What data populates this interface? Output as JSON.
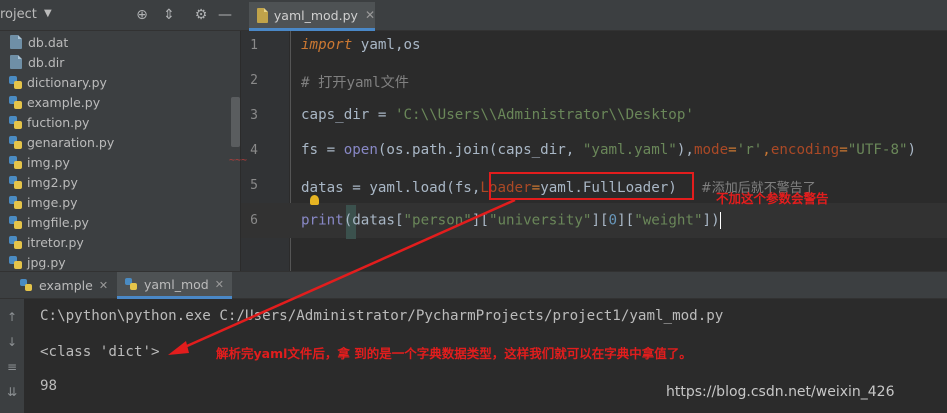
{
  "project_panel": {
    "title": "roject",
    "files": [
      {
        "name": "db.dat",
        "type": "dat"
      },
      {
        "name": "db.dir",
        "type": "dat"
      },
      {
        "name": "dictionary.py",
        "type": "py"
      },
      {
        "name": "example.py",
        "type": "py"
      },
      {
        "name": "fuction.py",
        "type": "py"
      },
      {
        "name": "genaration.py",
        "type": "py"
      },
      {
        "name": "img.py",
        "type": "py"
      },
      {
        "name": "img2.py",
        "type": "py"
      },
      {
        "name": "imge.py",
        "type": "py"
      },
      {
        "name": "imgfile.py",
        "type": "py"
      },
      {
        "name": "itretor.py",
        "type": "py"
      },
      {
        "name": "jpg.py",
        "type": "py"
      }
    ]
  },
  "editor": {
    "tab_label": "yaml_mod.py",
    "line_numbers": [
      "1",
      "2",
      "3",
      "4",
      "5",
      "6"
    ],
    "lines": {
      "l1": {
        "kw": "import",
        "rest": " yaml,os"
      },
      "l2": {
        "comment": "# 打开yaml文件"
      },
      "l3": {
        "var": "caps_dir",
        "eq": " = ",
        "str": "'C:\\\\Users\\\\Administrator\\\\Desktop'"
      },
      "l4": {
        "a": "fs = ",
        "fn": "open",
        "b": "(os.path.join(caps_dir, ",
        "s1": "\"yaml.yaml\"",
        "c": "),",
        "p1": "mode",
        "e1": "=",
        "s2": "'r'",
        "c2": ",",
        "p2": "encoding",
        "e2": "=",
        "s3": "\"UTF-8\"",
        "d": ")"
      },
      "l5": {
        "a": "datas = yaml.",
        "fn": "load",
        "b": "(fs,",
        "p": "Loader",
        "e": "=",
        "c": "yaml.FullLoader)",
        "comment": "#添加后就不警告了"
      },
      "l6": {
        "fn": "print",
        "a": "(datas[",
        "s1": "\"person\"",
        "b": "][",
        "s2": "\"university\"",
        "c": "][",
        "n": "0",
        "d": "][",
        "s3": "\"weight\"",
        "e": "])"
      }
    }
  },
  "annotations": {
    "editor_note": "不加这个参数会警告",
    "console_note": "解析完yaml文件后，拿 到的是一个字典数据类型，这样我们就可以在字典中拿值了。",
    "color": "#e21d1d"
  },
  "run_panel": {
    "tabs": [
      "example",
      "yaml_mod"
    ],
    "console_lines": [
      "C:\\python\\python.exe C:/Users/Administrator/PycharmProjects/project1/yaml_mod.py",
      "<class 'dict'>",
      "98"
    ]
  },
  "watermark": "https://blog.csdn.net/weixin_426",
  "colors": {
    "background": "#2b2b2b",
    "panel": "#3c3f41",
    "keyword": "#cc7832",
    "string": "#6a8759",
    "comment": "#808080",
    "builtin": "#8888c6",
    "parameter": "#aa4926"
  }
}
